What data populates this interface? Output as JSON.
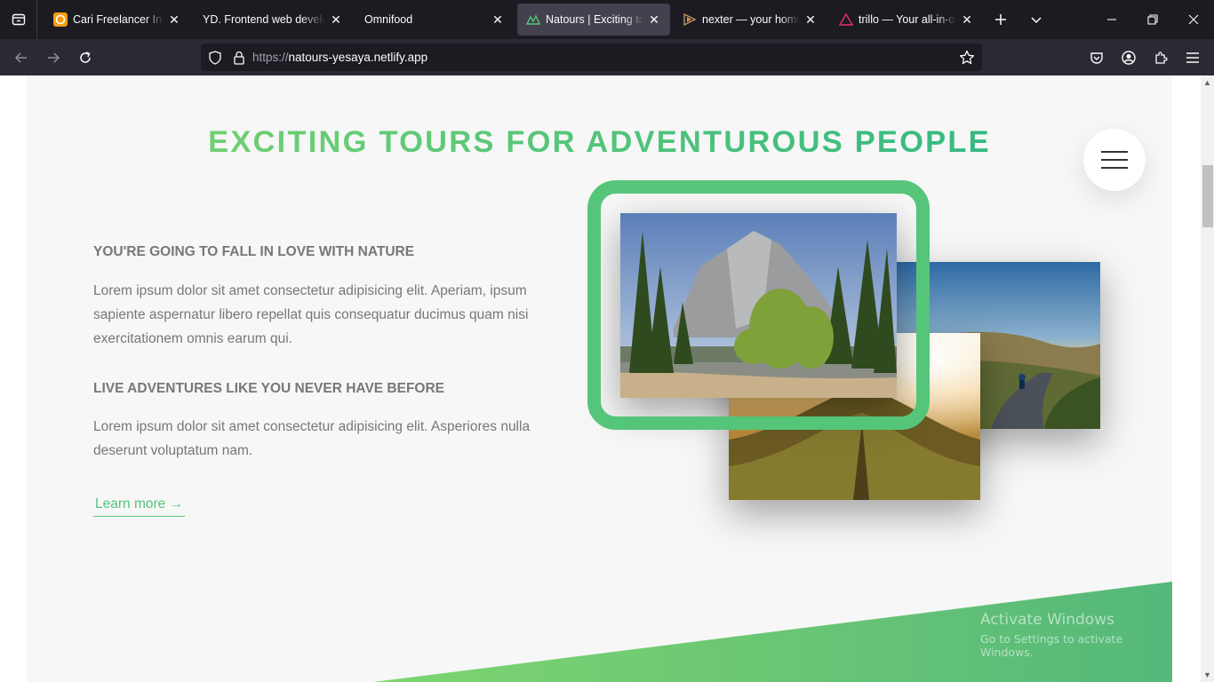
{
  "browser": {
    "tabs": [
      {
        "title": "Cari Freelancer Indonesia",
        "icon": "freelancer-favicon"
      },
      {
        "title": "YD. Frontend web developer",
        "icon": "none"
      },
      {
        "title": "Omnifood",
        "icon": "none"
      },
      {
        "title": "Natours | Exciting tours",
        "icon": "natours-favicon",
        "active": true
      },
      {
        "title": "nexter — your home, your freedom",
        "icon": "nexter-favicon"
      },
      {
        "title": "trillo — Your all-in-one booking app",
        "icon": "trillo-favicon"
      }
    ],
    "url_scheme": "https://",
    "url_host": "natours-yesaya.netlify.app"
  },
  "page": {
    "heading": "Exciting tours for adventurous people",
    "blocks": [
      {
        "title": "You're going to fall in love with nature",
        "text": "Lorem ipsum dolor sit amet consectetur adipisicing elit. Aperiam, ipsum sapiente aspernatur libero repellat quis consequatur ducimus quam nisi exercitationem omnis earum qui."
      },
      {
        "title": "Live adventures like you never have before",
        "text": "Lorem ipsum dolor sit amet consectetur adipisicing elit. Asperiores nulla deserunt voluptatum nam."
      }
    ],
    "learn_more": "Learn more →",
    "colors": {
      "primary_light": "#7ed56f",
      "primary": "#55c57a",
      "primary_dark": "#28b485",
      "text": "#777777"
    }
  },
  "system": {
    "watermark_title": "Activate Windows",
    "watermark_sub": "Go to Settings to activate Windows."
  }
}
